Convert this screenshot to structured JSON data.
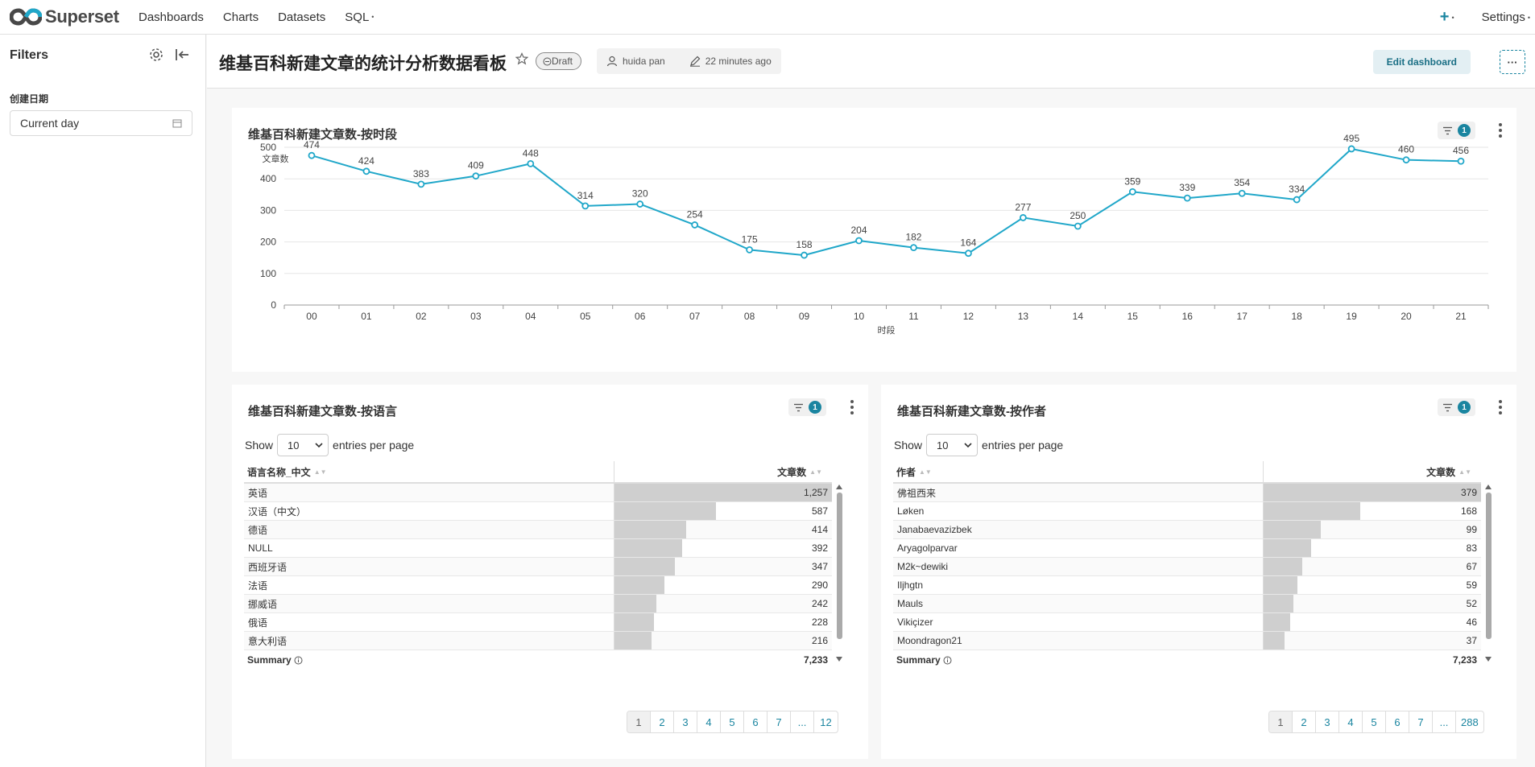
{
  "nav": {
    "logo_text": "Superset",
    "items": [
      "Dashboards",
      "Charts",
      "Datasets",
      "SQL"
    ],
    "plus": "+",
    "settings": "Settings"
  },
  "sidebar": {
    "title": "Filters",
    "filter_label": "创建日期",
    "filter_value": "Current day"
  },
  "header": {
    "title": "维基百科新建文章的统计分析数据看板",
    "status": "Draft",
    "owner": "huida pan",
    "modified": "22 minutes ago",
    "edit_label": "Edit dashboard",
    "more_label": "···"
  },
  "line_card": {
    "title": "维基百科新建文章数-按时段",
    "filter_count": "1"
  },
  "chart_data": {
    "type": "line",
    "x": [
      "00",
      "01",
      "02",
      "03",
      "04",
      "05",
      "06",
      "07",
      "08",
      "09",
      "10",
      "11",
      "12",
      "13",
      "14",
      "15",
      "16",
      "17",
      "18",
      "19",
      "20",
      "21"
    ],
    "values": [
      474,
      424,
      383,
      409,
      448,
      314,
      320,
      254,
      175,
      158,
      204,
      182,
      164,
      277,
      250,
      359,
      339,
      354,
      334,
      495,
      460,
      456
    ],
    "ylabel": "文章数",
    "xlabel": "时段",
    "yticks": [
      0,
      100,
      200,
      300,
      400,
      500
    ],
    "ylim": [
      0,
      520
    ],
    "color": "#20a7c9",
    "grid": true
  },
  "lang_table": {
    "title": "维基百科新建文章数-按语言",
    "filter_count": "1",
    "show": "Show",
    "page_size": "10",
    "entries": "entries per page",
    "col_name": "语言名称_中文",
    "col_value": "文章数",
    "max": 1257,
    "rows": [
      {
        "name": "英语",
        "value": "1,257",
        "num": 1257
      },
      {
        "name": "汉语（中文）",
        "value": "587",
        "num": 587
      },
      {
        "name": "德语",
        "value": "414",
        "num": 414
      },
      {
        "name": "NULL",
        "value": "392",
        "num": 392
      },
      {
        "name": "西班牙语",
        "value": "347",
        "num": 347
      },
      {
        "name": "法语",
        "value": "290",
        "num": 290
      },
      {
        "name": "挪威语",
        "value": "242",
        "num": 242
      },
      {
        "name": "俄语",
        "value": "228",
        "num": 228
      },
      {
        "name": "意大利语",
        "value": "216",
        "num": 216
      }
    ],
    "summary_label": "Summary",
    "summary_value": "7,233",
    "pages": [
      "1",
      "2",
      "3",
      "4",
      "5",
      "6",
      "7",
      "...",
      "12"
    ]
  },
  "author_table": {
    "title": "维基百科新建文章数-按作者",
    "filter_count": "1",
    "show": "Show",
    "page_size": "10",
    "entries": "entries per page",
    "col_name": "作者",
    "col_value": "文章数",
    "max": 379,
    "rows": [
      {
        "name": "佛祖西来",
        "value": "379",
        "num": 379
      },
      {
        "name": "Løken",
        "value": "168",
        "num": 168
      },
      {
        "name": "Janabaevazizbek",
        "value": "99",
        "num": 99
      },
      {
        "name": "Aryagolparvar",
        "value": "83",
        "num": 83
      },
      {
        "name": "M2k~dewiki",
        "value": "67",
        "num": 67
      },
      {
        "name": "Iljhgtn",
        "value": "59",
        "num": 59
      },
      {
        "name": "Mauls",
        "value": "52",
        "num": 52
      },
      {
        "name": "Vikiçizer",
        "value": "46",
        "num": 46
      },
      {
        "name": "Moondragon21",
        "value": "37",
        "num": 37
      }
    ],
    "summary_label": "Summary",
    "summary_value": "7,233",
    "pages": [
      "1",
      "2",
      "3",
      "4",
      "5",
      "6",
      "7",
      "...",
      "288"
    ]
  }
}
